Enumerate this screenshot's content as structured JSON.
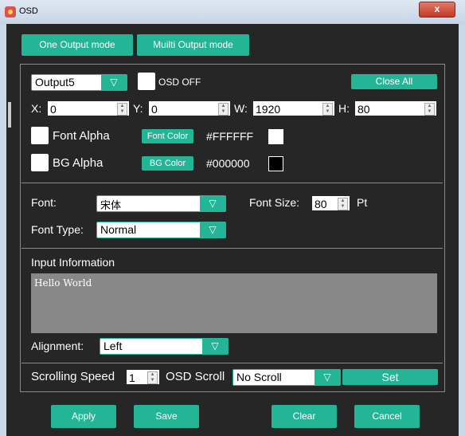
{
  "window": {
    "title": "OSD",
    "close_label": "x"
  },
  "modes": {
    "one_output": "One Output mode",
    "multi_output": "Muilti Output mode"
  },
  "output_select": {
    "value": "Output5"
  },
  "osd_off_label": "OSD OFF",
  "close_all_label": "Close All",
  "position": {
    "x_label": "X:",
    "x_value": "0",
    "y_label": "Y:",
    "y_value": "0",
    "w_label": "W:",
    "w_value": "1920",
    "h_label": "H:",
    "h_value": "80"
  },
  "font_alpha": {
    "label": "Font Alpha",
    "button": "Font Color",
    "color_text": "#FFFFFF",
    "swatch_color": "#FFFFFF"
  },
  "bg_alpha": {
    "label": "BG Alpha",
    "button": "BG Color",
    "color_text": "#000000",
    "swatch_color": "#000000"
  },
  "font": {
    "label": "Font:",
    "value": "宋体",
    "size_label": "Font Size:",
    "size_value": "80",
    "size_unit": "Pt"
  },
  "font_type": {
    "label": "Font Type:",
    "value": "Normal"
  },
  "input_info": {
    "label": "Input Information",
    "text": "Hello World"
  },
  "alignment": {
    "label": "Alignment:",
    "value": "Left"
  },
  "scroll": {
    "speed_label": "Scrolling Speed",
    "speed_value": "1",
    "osd_scroll_label": "OSD Scroll",
    "osd_scroll_value": "No Scroll",
    "set_label": "Set"
  },
  "buttons": {
    "apply": "Apply",
    "save": "Save",
    "clear": "Clear",
    "cancel": "Cancel"
  },
  "colors": {
    "accent": "#23b595",
    "background": "#262626"
  }
}
